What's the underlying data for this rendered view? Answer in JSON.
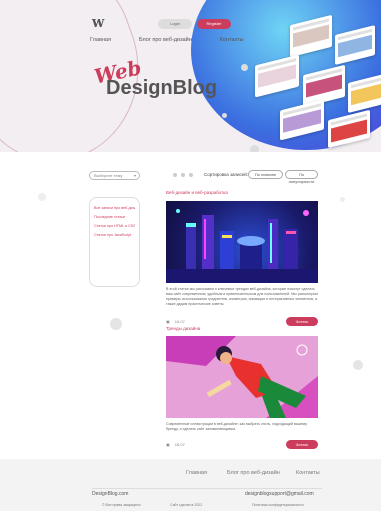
{
  "header": {
    "logo_text": "W",
    "login_label": "Login",
    "register_label": "Register",
    "nav": [
      "Главная",
      "Блог про веб-дизайн",
      "Контакты"
    ],
    "brand_web": "Web",
    "brand_design": "DesignBlog"
  },
  "toolbar": {
    "select_placeholder": "Выберите тему",
    "sort_label": "Сортировка записей:",
    "sort_options": [
      "По новизне",
      "По популярности"
    ]
  },
  "sidebar": {
    "items": [
      "Все записи про веб-дизайн",
      "Последние статьи",
      "Статьи про HTML и CSS",
      "Статьи про JavaScript"
    ]
  },
  "posts": [
    {
      "tag": "Веб-дизайн и веб-разработка",
      "text": "В этой статье мы расскажем о ключевых трендах веб-дизайна, которые помогут сделать ваш сайт современным, удобным и привлекательным для пользователей. Мы рассмотрим примеры использования градиентов, изометрии, анимации и интерактивных элементов, а также дадим практические советы.",
      "date": "18.07",
      "views": "342",
      "read_label": "Читать"
    },
    {
      "tag": "Тренды дизайна",
      "text": "Современные иллюстрации в веб-дизайне: как выбрать стиль, подходящий вашему бренду, и сделать сайт запоминающимся.",
      "date": "18.07",
      "views": "214",
      "read_label": "Читать"
    }
  ],
  "footer": {
    "logo_text": "W",
    "nav": [
      "Главная",
      "Блог про веб-дизайн",
      "Контакты"
    ],
    "brand": "DesignBlog.com",
    "email": "designblogsupport@gmail.com",
    "copyright": "© Все права защищены",
    "made_by": "Сайт сделан в 2022",
    "policy": "Политика конфиденциальности"
  },
  "colors": {
    "accent": "#cc3d5d",
    "hero_bg": "#f2eef1"
  }
}
